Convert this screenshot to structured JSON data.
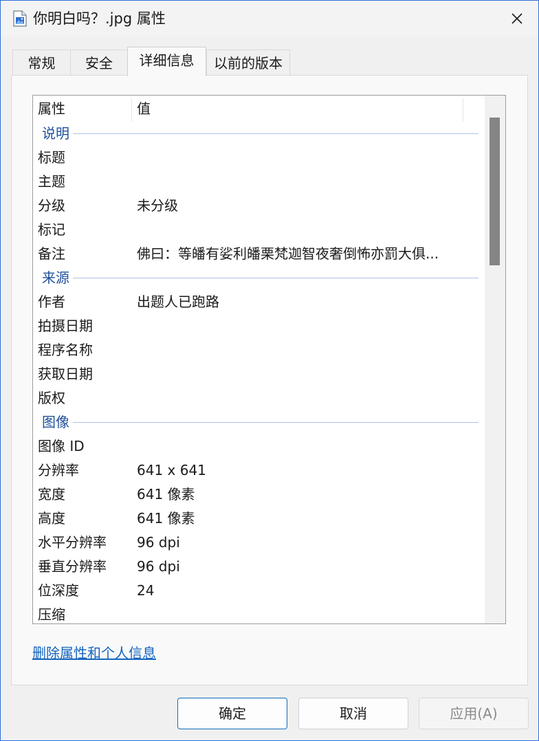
{
  "window": {
    "title": "你明白吗？.jpg 属性",
    "close_glyph": "✕"
  },
  "tabs": [
    {
      "label": "常规"
    },
    {
      "label": "安全"
    },
    {
      "label": "详细信息"
    },
    {
      "label": "以前的版本"
    }
  ],
  "table": {
    "col_property": "属性",
    "col_value": "值",
    "groups": [
      {
        "label": "说明",
        "rows": [
          {
            "name": "标题",
            "value": ""
          },
          {
            "name": "主题",
            "value": ""
          },
          {
            "name": "分级",
            "value": "未分级"
          },
          {
            "name": "标记",
            "value": ""
          },
          {
            "name": "备注",
            "value": "佛曰：等皤有娑利皤栗梵迦智夜奢倒怖亦罰大俱..."
          }
        ]
      },
      {
        "label": "来源",
        "rows": [
          {
            "name": "作者",
            "value": "出题人已跑路"
          },
          {
            "name": "拍摄日期",
            "value": ""
          },
          {
            "name": "程序名称",
            "value": ""
          },
          {
            "name": "获取日期",
            "value": ""
          },
          {
            "name": "版权",
            "value": ""
          }
        ]
      },
      {
        "label": "图像",
        "rows": [
          {
            "name": "图像 ID",
            "value": ""
          },
          {
            "name": "分辨率",
            "value": "641 x 641"
          },
          {
            "name": "宽度",
            "value": "641 像素"
          },
          {
            "name": "高度",
            "value": "641 像素"
          },
          {
            "name": "水平分辨率",
            "value": "96 dpi"
          },
          {
            "name": "垂直分辨率",
            "value": "96 dpi"
          },
          {
            "name": "位深度",
            "value": "24"
          },
          {
            "name": "压缩",
            "value": ""
          }
        ]
      }
    ]
  },
  "remove_link": "删除属性和个人信息",
  "buttons": {
    "ok": "确定",
    "cancel": "取消",
    "apply": "应用(A)"
  },
  "colors": {
    "accent": "#0f6cbd",
    "group_text": "#1f4f9a",
    "link": "#1565c0"
  },
  "icons": {
    "title": "image-file-icon",
    "close": "close-icon"
  }
}
